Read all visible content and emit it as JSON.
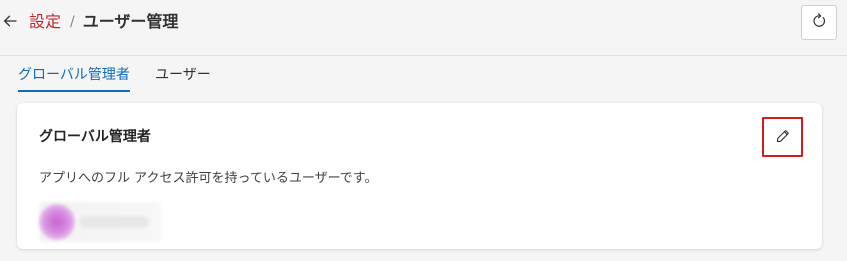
{
  "header": {
    "breadcrumb_parent": "設定",
    "breadcrumb_separator": "/",
    "breadcrumb_current": "ユーザー管理"
  },
  "tabs": [
    {
      "label": "グローバル管理者",
      "active": true
    },
    {
      "label": "ユーザー",
      "active": false
    }
  ],
  "card": {
    "title": "グローバル管理者",
    "description": "アプリへのフル アクセス許可を持っているユーザーです。"
  },
  "icons": {
    "back": "arrow-left-icon",
    "refresh": "refresh-icon",
    "edit": "pencil-icon"
  },
  "colors": {
    "breadcrumb_link": "#c4262e",
    "tab_active": "#0f6cbd",
    "edit_highlight": "#d41c1c",
    "avatar": "#c764d2"
  }
}
